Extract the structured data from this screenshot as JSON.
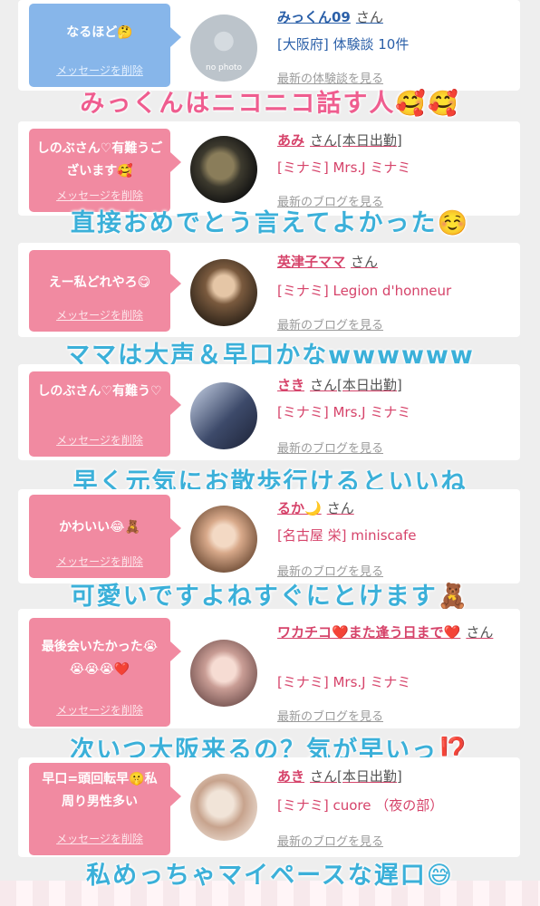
{
  "items": [
    {
      "msg": "なるほど🤔",
      "delete": "メッセージを削除",
      "avatar": "no photo",
      "name": "みっくん09",
      "san": "さん",
      "shop": "[大阪府] 体験談 10件",
      "latest": "最新の体験談を見る",
      "caption": "みっくんはニコニコ話す人🥰🥰"
    },
    {
      "msg": "しのぶさん♡有難うございます🥰",
      "delete": "メッセージを削除",
      "name": "あみ",
      "san": "さん[本日出勤]",
      "shop": "[ミナミ] Mrs.J ミナミ",
      "latest": "最新のブログを見る",
      "caption": "直接おめでとう言えてよかった☺️"
    },
    {
      "msg": "えー私どれやろ😋",
      "delete": "メッセージを削除",
      "name": "英津子ママ",
      "san": "さん",
      "shop": "[ミナミ] Legion d'honneur",
      "latest": "最新のブログを見る",
      "caption": "ママは大声＆早口かなwwwwww"
    },
    {
      "msg": "しのぶさん♡有難う♡",
      "delete": "メッセージを削除",
      "name": "さき",
      "san": "さん[本日出勤]",
      "shop": "[ミナミ] Mrs.J ミナミ",
      "latest": "最新のブログを見る",
      "caption": "早く元気にお散歩行けるといいね"
    },
    {
      "msg": "かわいい😂🧸",
      "delete": "メッセージを削除",
      "name": "るか🌙",
      "san": "さん",
      "shop": "[名古屋 栄] miniscafe",
      "latest": "最新のブログを見る",
      "caption": "可愛いですよねすぐにとけます🧸"
    },
    {
      "msg": "最後会いたかった😭😭😭😭❤️",
      "delete": "メッセージを削除",
      "name": "ワカチコ❤️また逢う日まで❤️",
      "san": "さん",
      "shop": "[ミナミ] Mrs.J ミナミ",
      "latest": "最新のブログを見る",
      "caption": "次いつ大阪来るの？気が早いっ⁉️"
    },
    {
      "msg": "早口=頭回転早🤫私周り男性多い",
      "delete": "メッセージを削除",
      "name": "あき",
      "san": "さん[本日出勤]",
      "shop": "[ミナミ] cuore （夜の部）",
      "latest": "最新のブログを見る",
      "caption": "私めっちゃマイペースな遅口😅"
    }
  ],
  "colors": {
    "pink_bubble": "#f18aa1",
    "blue_bubble": "#87b6ea",
    "name_pink": "#d6436a",
    "name_blue": "#2a5fa8",
    "caption_blue": "#3bb0d9",
    "caption_pink": "#ef5d8f"
  }
}
